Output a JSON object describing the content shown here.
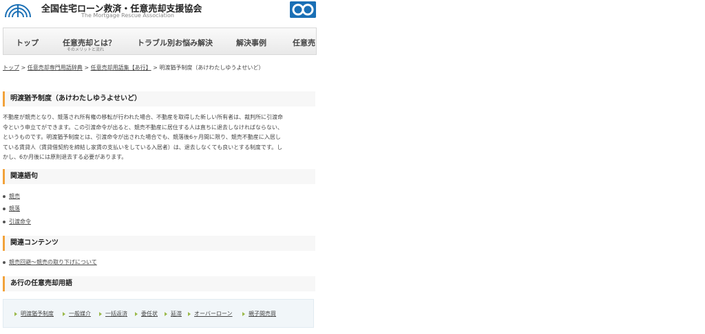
{
  "header": {
    "site_title": "全国住宅ローン救済・任意売却支援協会",
    "site_subtitle": "The Mortgage Rescue Association",
    "logo_icon": "fan-logo-icon",
    "freedial_icon": "freedial-icon"
  },
  "nav": {
    "items": [
      {
        "label": "トップ"
      },
      {
        "label": "任意売却とは？",
        "sub": "そのメリットと流れ"
      },
      {
        "label": "トラブル別お悩み解決"
      },
      {
        "label": "解決事例"
      },
      {
        "label": "任意売"
      }
    ]
  },
  "breadcrumb": {
    "items": [
      "トップ",
      "任意売却専門用語辞典",
      "任意売却用語集【あ行】"
    ],
    "current": "明渡猶予制度（あけわたしゆうよせいど）",
    "separator": ">"
  },
  "article": {
    "title": "明渡猶予制度（あけわたしゆうよせいど）",
    "lines": [
      "不動産が競売となり、競落され所有権の移転が行われた場合、不動産を取得した新しい所有者は、裁判所に引渡命",
      "令という申立てができます。この引渡命令が出ると、競売不動産に居住する人は直ちに退去しなければならない、",
      "というものです。明渡猶予制度とは、引渡命令が出された場合でも、競落後6ヶ月間に限り、競売不動産に入居し",
      "ている賃貸人（賃貸借契約を締結し家賃の支払いをしている入居者）は、退去しなくても良いとする制度です。し",
      "かし、6か月後には原則退去する必要があります。"
    ]
  },
  "related_terms": {
    "heading": "関連語句",
    "items": [
      "競売",
      "競落",
      "引渡命令"
    ]
  },
  "related_contents": {
    "heading": "関連コンテンツ",
    "items": [
      "競売回避～競売の取り下げについて"
    ]
  },
  "a_row_terms": {
    "heading": "あ行の任意売却用語",
    "items": [
      "明渡猶予制度",
      "一般媒介",
      "一括返済",
      "委任状",
      "延滞",
      "オーバーローン",
      "親子間売買"
    ]
  },
  "colors": {
    "accent": "#f2a23a",
    "freedial": "#1a6fb5",
    "term_bullet": "#9bb94a"
  }
}
